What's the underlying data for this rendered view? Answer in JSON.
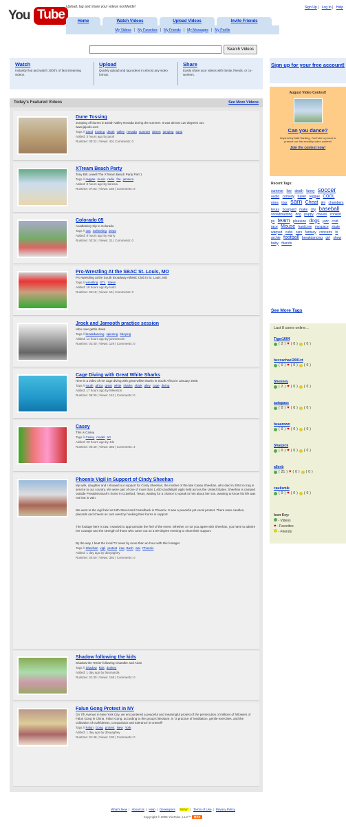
{
  "header": {
    "logo_you": "You",
    "logo_tube": "Tube",
    "tagline": "Upload, tag and share your videos worldwide!",
    "toplinks": [
      "Sign Up",
      "Log In",
      "Help"
    ],
    "tabs": [
      "Home",
      "Watch Videos",
      "Upload Videos",
      "Invite Friends"
    ],
    "subnav": [
      "My Videos",
      "My Favorites",
      "My Friends",
      "My Messages",
      "My Profile"
    ],
    "search_button": "Search Videos"
  },
  "promo": {
    "watch": {
      "title": "Watch",
      "text": "Instantly find and watch 1000's of fast streaming videos."
    },
    "upload": {
      "title": "Upload",
      "text": "Quickly upload and tag videos in almost any video format."
    },
    "share": {
      "title": "Share",
      "text": "Easily share your videos with family, friends, or co-workers."
    }
  },
  "featured": {
    "heading": "Today's Featured Videos",
    "see_more": "See More Videos",
    "videos": [
      {
        "title": "Dune Tossing",
        "desc": "Jumping off dunes in Death Valley Nevada during the summer. It was almost 120 degrees out.\nwww.jajools.com",
        "tags": [
          "Sand",
          "tossing",
          "death",
          "valley",
          "nevada",
          "summer",
          "desert",
          "jumping",
          "sand"
        ],
        "added": "Added: 3 hours ago by jaroil",
        "stats": "Runtime: 00:22 | Views: 40 | Comments: 0"
      },
      {
        "title": "XTream Beach Party",
        "desc": "Tony Brk Lewell The XTream Beach Party Part 1",
        "tags": [
          "reggae",
          "music",
          "radio",
          "fire",
          "jamaica"
        ],
        "added": "Added: 8 hours ago by karesia",
        "stats": "Runtime: 07:03 | Views: 150 | Comments: 0"
      },
      {
        "title": "Colorado 05",
        "desc": "Acadiankey trip to Colorado",
        "tags": [
          "4x4",
          "4wheeling",
          "jeeps"
        ],
        "added": "Added: 9 hours ago by Harry",
        "stats": "Runtime: 03:34 | Views: 21 | Comments: 0"
      },
      {
        "title": "Pro-Wrestling At the SBAC St. Louis, MO",
        "desc": "Pro Wrestling at the South Broadway Athletic Club in St. Louis, MO",
        "tags": [
          "wrestling",
          "STL",
          "Steve"
        ],
        "added": "Added: 10 hours ago by todd",
        "stats": "Runtime: 04:18 | Views: 16 | Comments: 0"
      },
      {
        "title": "Jrock and Jamooth practice session",
        "desc": "rebo over gettin down",
        "tags": [
          "breakdancing",
          "spinning",
          "bboying"
        ],
        "added": "Added: 14 hours ago by jamsessoin",
        "stats": "Runtime: 02:40 | Views: 129 | Comments: 0"
      },
      {
        "title": "Cage Diving with Great White Sharks",
        "desc": "Here is a video of me cage diving with great white sharks in South Africa in January 2005.",
        "tags": [
          "south",
          "africa",
          "great",
          "white",
          "sharks",
          "shark",
          "alley",
          "cage",
          "diving"
        ],
        "added": "Added: 17 hours ago by Mleeston",
        "stats": "Runtime: 06:30 | Views: 142 | Comments: 0"
      },
      {
        "title": "Casey",
        "desc": "This is Casey",
        "tags": [
          "Casey",
          "model",
          "art"
        ],
        "added": "Added: 20 hours ago by Jdo",
        "stats": "Runtime: 00:40 | Views: 356 | Comments: 4"
      },
      {
        "title": "Phoenix Vigil in Support of Cindy Sheehan",
        "desc": "My wife, daughter and I showed our support for Cindy Sheehan, the mother of the late Casey Sheehan, who died in 2004 in Iraq in service to our country. We were part of one of more than 1,400 candlelight vigils held across the United States. Sheehan is camped outside President Bush's home in Crawford, Texas, waiting for a chance to speak to him about her son, wanting to know his life was not lost in vain.\n\n\nWe went to the vigil held at 24th Street and Camelback in Phoenix. It was a peaceful yet vocal protest. There were candles, placards and cheers as cars went by honking their horns in support.\n\n\nThe footage here is raw. I wanted to approximate the feel of the event. Whether or not you agree with Sheehan, you have to admire her courage and the strength of those who came out on a 90-degree evening to show their support.\n\n\nBy the way, I beat the local TV news by more than an hour with this footage!",
        "tags": [
          "Sheehan",
          "vigil",
          "protest",
          "iraq",
          "Bush",
          "war",
          "Phoenix"
        ],
        "added": "Added: 1 day ago by dboyaghey",
        "stats": "Runtime: 04:50 | Views: 392 | Comments: 0"
      },
      {
        "title": "Shadow following the kids",
        "desc": "Shadow the Terrier following Chandler and Arian",
        "tags": [
          "Shadow",
          "kids",
          "donkey"
        ],
        "added": "Added: 1 day ago by bkumanda",
        "stats": "Runtime: 01:30 | Views: 168 | Comments: 0"
      },
      {
        "title": "Falun Gong Protest in NY",
        "desc": "On 7th Avenue in New York City, we encountered a peaceful and meaningful protest of the persecution of millions of followers of Falun Gong in China. Falun Gong, according to the group's literature, is \"a practice of meditation, gentle exercises, and the cultivation of truthfulness, compassion and tolerance in oneself\"",
        "tags": [
          "Falun",
          "Gong",
          "protest",
          "New",
          "York"
        ],
        "added": "Added: 1 day ago by dboyaghey",
        "stats": "Runtime: 01:48 | Views: 130 | Comments: 0"
      }
    ]
  },
  "sidebar": {
    "signup": "Sign up for your free account!",
    "contest_title": "August Video Contest!",
    "dance": "Can you dance?",
    "contest_desc": "Inspired by Matt Harding, YouTube is proud to present our first monthly video contest!",
    "join": "Join the contest now!",
    "recent_tags_label": "Recent Tags:",
    "tags": [
      "summer",
      "live",
      "death",
      "funny",
      "soccer",
      "audio",
      "comedy",
      "trailer",
      "reggae",
      "COOL",
      "ones",
      "tour",
      "sam",
      "Cheat",
      "jim",
      "chambers",
      "texas",
      "Scarpard",
      "make",
      "city",
      "baseball",
      "snowboarding",
      "dog",
      "puppy",
      "cheers",
      "contest",
      "ps",
      "team",
      "pleasure",
      "dogs",
      "jazz",
      "cold",
      "race",
      "Mouse",
      "hardcore",
      "myspace",
      "skate",
      "warped",
      "cubs",
      "cars",
      "fantasy",
      "concerts",
      "hi",
      "archie",
      "football",
      "breakdancing",
      "girl",
      "show",
      "baby",
      "friends"
    ],
    "more_tags": "See More Tags",
    "users_heading": "Last 8 users online...",
    "users": [
      {
        "name": "Tiger1604",
        "v": "2",
        "f": "0",
        "fr": "0"
      },
      {
        "name": "beccachael2001xt",
        "v": "0",
        "f": "0",
        "fr": "0"
      },
      {
        "name": "Shenney",
        "v": "2",
        "f": "0",
        "fr": "0"
      },
      {
        "name": "autopass",
        "v": "0",
        "f": "0",
        "fr": "0"
      },
      {
        "name": "beaurown",
        "v": "0",
        "f": "0",
        "fr": "0"
      },
      {
        "name": "Sharpick",
        "v": "0",
        "f": "0",
        "fr": "0"
      },
      {
        "name": "allenb",
        "v": "21",
        "f": "0",
        "fr": "0"
      },
      {
        "name": "caulismik",
        "v": "0",
        "f": "0",
        "fr": "0"
      }
    ],
    "icon_key_label": "Icon Key:",
    "icon_key": [
      "- Videos",
      "- Favorites",
      "- Friends"
    ]
  },
  "footer": {
    "links": [
      "What's New",
      "About Us",
      "Help",
      "Developers",
      "Terms of Use",
      "Privacy Policy"
    ],
    "new_badge": "NEW",
    "copyright": "Copyright © 2005 YouTube, LLC™",
    "rss": "RSS"
  },
  "colors": {
    "link": "#0033cc",
    "tab": "#cfe0f3",
    "promo": "#e5edf8",
    "contest": "#ffcc88",
    "logo_red": "#cc0000",
    "users_bg": "#eef0d8"
  }
}
